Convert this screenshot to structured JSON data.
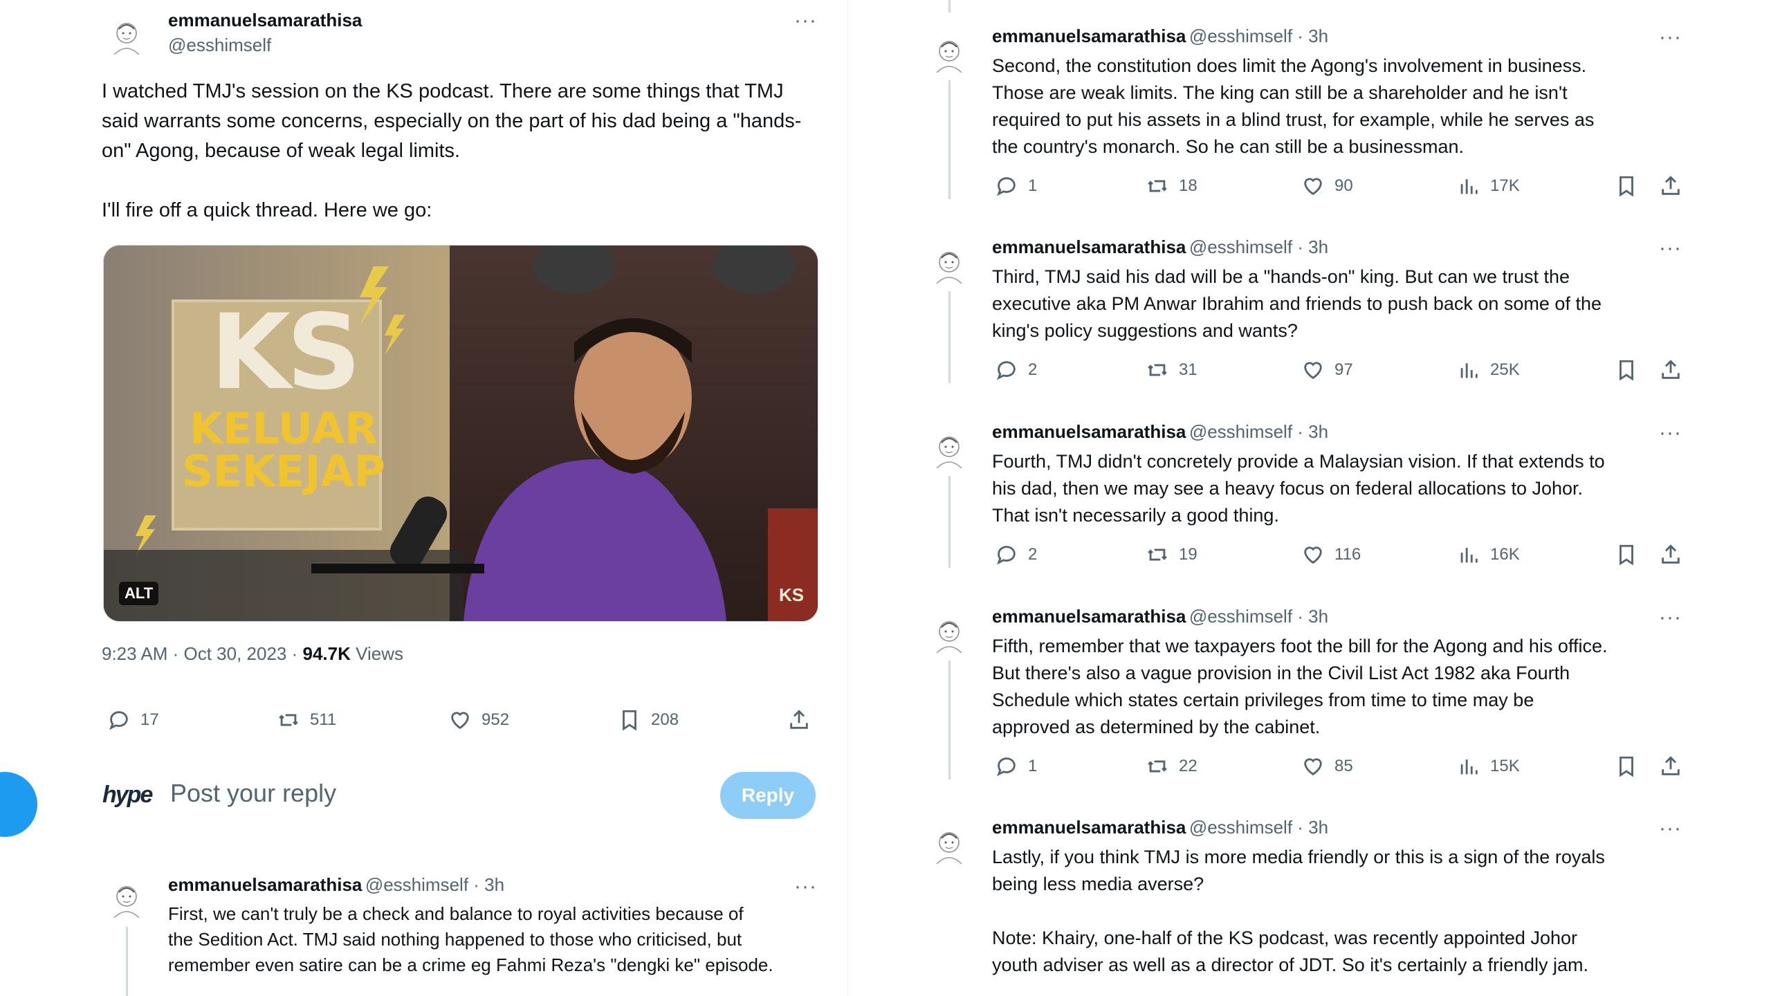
{
  "main_tweet": {
    "author_name": "emmanuelsamarathisa",
    "author_handle": "@esshimself",
    "text": "I watched TMJ's session on the KS podcast. There are some things that TMJ said warrants some concerns, especially on the part of his dad being a \"hands-on\" Agong, because of weak legal limits.\n\nI'll fire off a quick thread. Here we go:",
    "media": {
      "alt_badge": "ALT",
      "logo_line1": "KS",
      "logo_line2": "KELUAR",
      "logo_line3": "SEKEJAP",
      "watermark": "KS"
    },
    "timestamp": "9:23 AM · Oct 30, 2023 · ",
    "views_count": "94.7K",
    "views_label": " Views",
    "stats": {
      "replies": "17",
      "retweets": "511",
      "likes": "952",
      "bookmarks": "208"
    }
  },
  "reply_composer": {
    "avatar_label": "hype",
    "placeholder": "Post your reply",
    "button_label": "Reply"
  },
  "left_thread_tweet": {
    "author_name": "emmanuelsamarathisa",
    "author_handle": "@esshimself",
    "time": " · 3h",
    "text": "First, we can't truly be a check and balance to royal activities because of\nthe Sedition Act. TMJ said nothing happened to those who criticised, but\nremember even satire can be a crime eg Fahmi Reza's \"dengki ke\" episode."
  },
  "thread": [
    {
      "author_name": "emmanuelsamarathisa",
      "author_handle": "@esshimself",
      "time": " · 3h",
      "text": "Second, the constitution does limit the Agong's involvement in business.\nThose are weak limits. The king can still be a shareholder and he isn't\nrequired to put his assets in a blind trust, for example, while he serves as\nthe country's monarch. So he can still be a businessman.",
      "stats": {
        "replies": "1",
        "retweets": "18",
        "likes": "90",
        "views": "17K"
      }
    },
    {
      "author_name": "emmanuelsamarathisa",
      "author_handle": "@esshimself",
      "time": " · 3h",
      "text": "Third, TMJ said his dad will be a \"hands-on\" king. But can we trust the\nexecutive aka PM Anwar Ibrahim and friends to push back on some of the\nking's policy suggestions and wants?",
      "stats": {
        "replies": "2",
        "retweets": "31",
        "likes": "97",
        "views": "25K"
      }
    },
    {
      "author_name": "emmanuelsamarathisa",
      "author_handle": "@esshimself",
      "time": " · 3h",
      "text": "Fourth, TMJ didn't concretely provide a Malaysian vision. If that extends to\nhis dad, then we may see a heavy focus on federal allocations to Johor.\nThat isn't necessarily a good thing.",
      "stats": {
        "replies": "2",
        "retweets": "19",
        "likes": "116",
        "views": "16K"
      }
    },
    {
      "author_name": "emmanuelsamarathisa",
      "author_handle": "@esshimself",
      "time": " · 3h",
      "text": "Fifth, remember that we taxpayers foot the bill for the Agong and his office.\nBut there's also a vague provision in the Civil List Act 1982 aka Fourth\nSchedule which states certain privileges from time to time may be\napproved as determined by the cabinet.",
      "stats": {
        "replies": "1",
        "retweets": "22",
        "likes": "85",
        "views": "15K"
      }
    },
    {
      "author_name": "emmanuelsamarathisa",
      "author_handle": "@esshimself",
      "time": " · 3h",
      "text": "Lastly, if you think TMJ is more media friendly or this is a sign of the royals\nbeing less media averse?\n\nNote: Khairy, one-half of the KS podcast, was recently appointed Johor\nyouth adviser as well as a director of JDT. So it's certainly a friendly jam."
    }
  ],
  "colors": {
    "accent": "#1d9bf0",
    "reply_button": "#8ecdf8",
    "text_secondary": "#536471"
  }
}
